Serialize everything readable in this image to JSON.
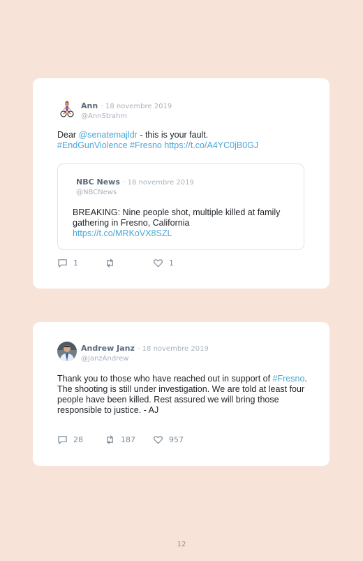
{
  "tweets": [
    {
      "name": "Ann",
      "date": "· 18 novembre 2019",
      "handle": "@AnnStrahm",
      "text_parts": {
        "p1": "Dear ",
        "mention": "@senatemajldr",
        "p2": " - this is your fault.",
        "hashtags": "#EndGunViolence #Fresno",
        "link": " https://t.co/A4YC0jB0GJ"
      },
      "quote": {
        "name": "NBC News",
        "date": "· 18 novembre 2019",
        "handle": "@NBCNews",
        "text": "BREAKING: Nine people shot, multiple killed at family gathering in Fresno, California",
        "link": "https://t.co/MRKoVX8SZL"
      },
      "actions": {
        "replies": "1",
        "retweets": "",
        "likes": "1"
      }
    },
    {
      "name": "Andrew Janz",
      "date": "· 18 novembre 2019",
      "handle": "@JanzAndrew",
      "text_parts": {
        "p1": "Thank you to those who have reached out in support of ",
        "hashtag": "#Fresno",
        "p2": ". The shooting is still under investigation. We are told at least four people have been killed. Rest assured we will bring those responsible to justice. - AJ"
      },
      "actions": {
        "replies": "28",
        "retweets": "187",
        "likes": "957"
      }
    }
  ],
  "page_number": "12",
  "colors": {
    "background": "#f8e3d8",
    "link": "#4aa7d8",
    "card": "#ffffff"
  },
  "icons": [
    "reply-icon",
    "retweet-icon",
    "like-icon"
  ]
}
